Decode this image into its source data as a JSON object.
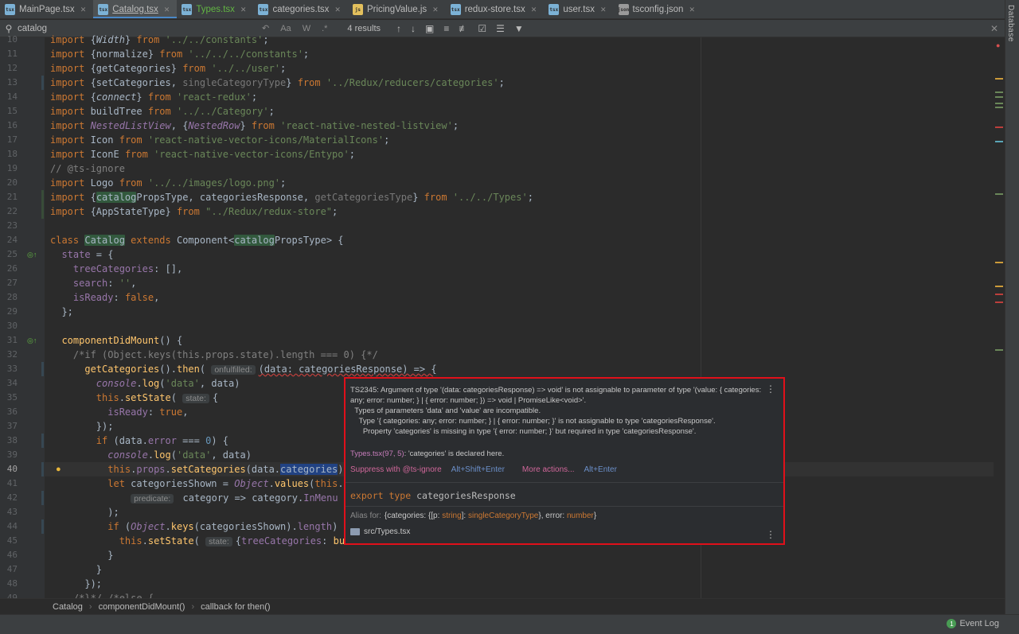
{
  "tabs": [
    {
      "name": "MainPage.tsx",
      "icon": "tsx",
      "color": "#7cb2d6",
      "active": false
    },
    {
      "name": "Catalog.tsx",
      "icon": "tsx",
      "color": "#7cb2d6",
      "active": true
    },
    {
      "name": "Types.tsx",
      "icon": "tsx",
      "color": "#7cb2d6",
      "active": false,
      "green": true
    },
    {
      "name": "categories.tsx",
      "icon": "tsx",
      "color": "#7cb2d6",
      "active": false
    },
    {
      "name": "PricingValue.js",
      "icon": "js",
      "color": "#e3c05d",
      "active": false
    },
    {
      "name": "redux-store.tsx",
      "icon": "tsx",
      "color": "#7cb2d6",
      "active": false
    },
    {
      "name": "user.tsx",
      "icon": "tsx",
      "color": "#7cb2d6",
      "active": false
    },
    {
      "name": "tsconfig.json",
      "icon": "json",
      "color": "#9a9a9a",
      "active": false
    }
  ],
  "side_panel": {
    "label": "Database"
  },
  "search": {
    "value": "catalog",
    "options": [
      "Aa",
      "W",
      ".*"
    ],
    "result_count": "4 results"
  },
  "code_lines": [
    {
      "n": "10",
      "html": "<span class='kw'>import</span> {<span class='it'>Width</span>} <span class='kw'>from</span> <span class='str'>'../../constants'</span>;"
    },
    {
      "n": "11",
      "html": "<span class='kw'>import</span> {normalize} <span class='kw'>from</span> <span class='str'>'../../../constants'</span>;"
    },
    {
      "n": "12",
      "html": "<span class='kw'>import</span> {getCategories} <span class='kw'>from</span> <span class='str'>'../../user'</span>;"
    },
    {
      "n": "13",
      "html": "<span class='kw'>import</span> {setCategories, <span class='gray'>singleCategoryType</span>} <span class='kw'>from</span> <span class='str'>'../Redux/reducers/categories'</span>;"
    },
    {
      "n": "14",
      "html": "<span class='kw'>import</span> {<span class='it'>connect</span>} <span class='kw'>from</span> <span class='str'>'react-redux'</span>;"
    },
    {
      "n": "15",
      "html": "<span class='kw'>import</span> buildTree <span class='kw'>from</span> <span class='str'>'../../Category'</span>;"
    },
    {
      "n": "16",
      "html": "<span class='kw'>import</span> <span class='prop it'>NestedListView</span>, {<span class='prop it'>NestedRow</span>} <span class='kw'>from</span> <span class='str'>'react-native-nested-listview'</span>;"
    },
    {
      "n": "17",
      "html": "<span class='kw'>import</span> Icon <span class='kw'>from</span> <span class='str'>'react-native-vector-icons/MaterialIcons'</span>;"
    },
    {
      "n": "18",
      "html": "<span class='kw'>import</span> IconE <span class='kw'>from</span> <span class='str'>'react-native-vector-icons/Entypo'</span>;"
    },
    {
      "n": "19",
      "html": "<span class='cmt'>// @ts-ignore</span>"
    },
    {
      "n": "20",
      "html": "<span class='kw'>import</span> Logo <span class='kw'>from</span> <span class='str'>'../../images/logo.png'</span>;"
    },
    {
      "n": "21",
      "html": "<span class='kw'>import</span> {<span class='hit'>catalog</span>PropsType, categoriesResponse, <span class='gray'>getCategoriesType</span>} <span class='kw'>from</span> <span class='str'>'../../Types'</span>;"
    },
    {
      "n": "22",
      "html": "<span class='kw'>import</span> {AppStateType} <span class='kw'>from</span> <span class='str'>\"../Redux/redux-store\"</span>;"
    },
    {
      "n": "23",
      "html": ""
    },
    {
      "n": "24",
      "html": "<span class='kw'>class</span> <span class='hit'>Catalog</span> <span class='kw'>extends</span> Component&lt;<span class='hit'>catalog</span>PropsType&gt; {"
    },
    {
      "n": "25",
      "html": "  <span class='prop'>state</span> = {"
    },
    {
      "n": "26",
      "html": "    <span class='prop'>treeCategories</span>: [],"
    },
    {
      "n": "27",
      "html": "    <span class='prop'>search</span>: <span class='str'>''</span>,"
    },
    {
      "n": "28",
      "html": "    <span class='prop'>isReady</span>: <span class='kw'>false</span>,"
    },
    {
      "n": "29",
      "html": "  };"
    },
    {
      "n": "30",
      "html": ""
    },
    {
      "n": "31",
      "html": "  <span class='fn'>componentDidMount</span>() {"
    },
    {
      "n": "32",
      "html": "    <span class='cmt'>/*if (Object.keys(this.props.state).length === 0) {*/</span>"
    },
    {
      "n": "33",
      "html": "      <span class='fn'>getCategories</span>().<span class='fn'>then</span>( <span class='hint'>onfulfilled:</span><span class='errul'>(data: categoriesResponse) =&gt; {</span>"
    },
    {
      "n": "34",
      "html": "        <span class='prop it'>console</span>.<span class='fn'>log</span>(<span class='str'>'data'</span>, data)"
    },
    {
      "n": "35",
      "html": "        <span class='kw'>this</span>.<span class='fn'>setState</span>( <span class='hint'>state:</span>{"
    },
    {
      "n": "36",
      "html": "          <span class='prop'>isReady</span>: <span class='kw'>true</span>,"
    },
    {
      "n": "37",
      "html": "        });"
    },
    {
      "n": "38",
      "html": "        <span class='kw'>if</span> (data.<span class='prop'>error</span> === <span class='num'>0</span>) {"
    },
    {
      "n": "39",
      "html": "          <span class='prop it'>console</span>.<span class='fn'>log</span>(<span class='str'>'data'</span>, data)"
    },
    {
      "n": "40",
      "html": "          <span class='kw'>this</span>.<span class='prop'>props</span>.<span class='fn'>setCategories</span>(data.<span class='sel'>categories</span>);"
    },
    {
      "n": "41",
      "html": "          <span class='kw'>let</span> categoriesShown = <span class='prop it'>Object</span>.<span class='fn'>values</span>(<span class='kw'>this</span>.<span class='prop'>pro</span>"
    },
    {
      "n": "42",
      "html": "              <span class='hint'>predicate:</span> category =&gt; category.<span class='prop'>InMenu</span> === <span class='str'>'1</span>"
    },
    {
      "n": "43",
      "html": "          );"
    },
    {
      "n": "44",
      "html": "          <span class='kw'>if</span> (<span class='prop it'>Object</span>.<span class='fn'>keys</span>(categoriesShown).<span class='prop'>length</span>) {"
    },
    {
      "n": "45",
      "html": "            <span class='kw'>this</span>.<span class='fn'>setState</span>( <span class='hint'>state:</span>{<span class='prop'>treeCategories</span>: <span class='fn'>buildT</span>"
    },
    {
      "n": "46",
      "html": "          }"
    },
    {
      "n": "47",
      "html": "        }"
    },
    {
      "n": "48",
      "html": "      });"
    },
    {
      "n": "49",
      "html": "    <span class='cmt'>/*}*/ /*else {</span>"
    }
  ],
  "breadcrumb": [
    "Catalog",
    "componentDidMount()",
    "callback for then()"
  ],
  "popup": {
    "error_text": "TS2345: Argument of type '(data: categoriesResponse) => void' is not assignable to parameter of type '(value: { categories: any; error: number; } | { error: number; }) => void | PromiseLike<void>'.\n  Types of parameters 'data' and 'value' are incompatible.\n    Type '{ categories: any; error: number; } | { error: number; }' is not assignable to type 'categoriesResponse'.\n      Property 'categories' is missing in type '{ error: number; }' but required in type 'categoriesResponse'.",
    "decl_link": "Types.tsx(97, 5)",
    "decl_text": ": 'categories' is declared here.",
    "action1": "Suppress with @ts-ignore",
    "action1_shortcut": "Alt+Shift+Enter",
    "action2": "More actions...",
    "action2_shortcut": "Alt+Enter",
    "export_kw": "export type",
    "export_name": "categoriesResponse",
    "alias_label": "Alias for:",
    "alias_open": "{categories: {[p: ",
    "alias_t1": "string",
    "alias_mid": "]: ",
    "alias_t2": "singleCategoryType",
    "alias_mid2": "}, error: ",
    "alias_t3": "number",
    "alias_close": "}",
    "source_path": "src/Types.tsx"
  },
  "status": {
    "event_log": "Event Log",
    "event_count": "1"
  },
  "colors": {
    "accent": "#4a88c7",
    "error_border": "#e0101a",
    "match_bg": "#32593d"
  }
}
